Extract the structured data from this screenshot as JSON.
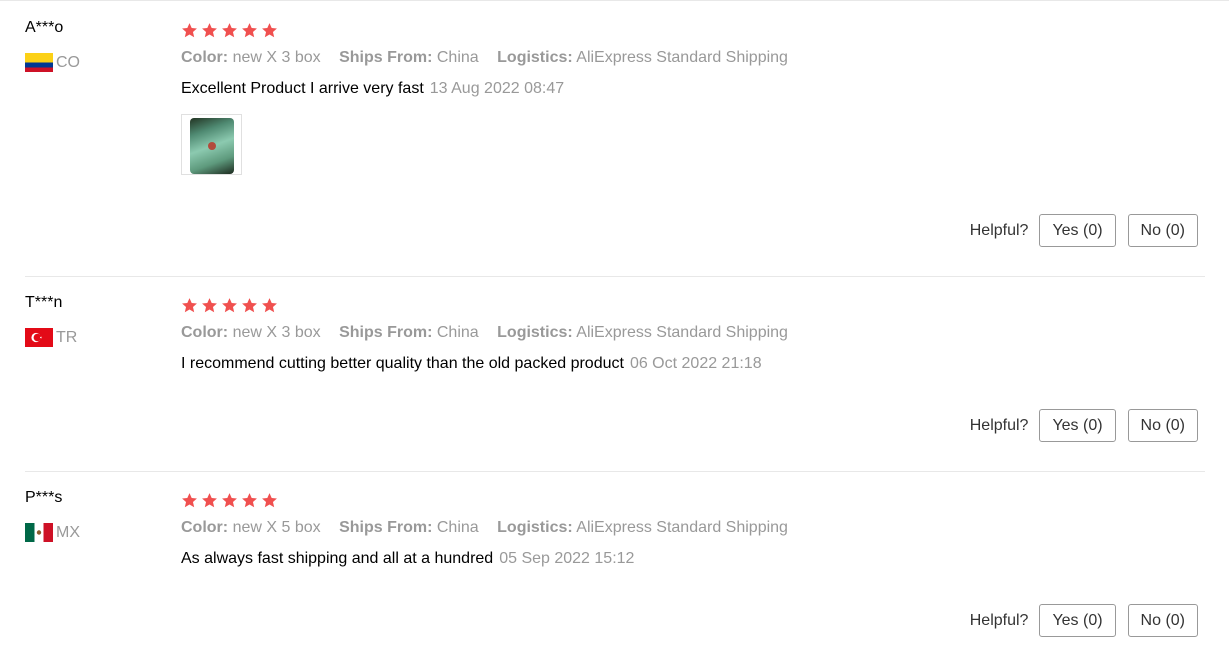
{
  "reviews": [
    {
      "user": "A***o",
      "country_code": "CO",
      "flag_icon": "flag-colombia",
      "rating": 5,
      "color_label": "Color:",
      "color_value": "new X 3 box",
      "ships_label": "Ships From:",
      "ships_value": "China",
      "logistics_label": "Logistics:",
      "logistics_value": "AliExpress Standard Shipping",
      "comment": "Excellent Product I arrive very fast",
      "date": "13 Aug 2022 08:47",
      "has_photo": true,
      "helpful_label": "Helpful?",
      "yes_label": "Yes (0)",
      "no_label": "No (0)"
    },
    {
      "user": "T***n",
      "country_code": "TR",
      "flag_icon": "flag-turkey",
      "rating": 5,
      "color_label": "Color:",
      "color_value": "new X 3 box",
      "ships_label": "Ships From:",
      "ships_value": "China",
      "logistics_label": "Logistics:",
      "logistics_value": "AliExpress Standard Shipping",
      "comment": "I recommend cutting better quality than the old packed product",
      "date": "06 Oct 2022 21:18",
      "has_photo": false,
      "helpful_label": "Helpful?",
      "yes_label": "Yes (0)",
      "no_label": "No (0)"
    },
    {
      "user": "P***s",
      "country_code": "MX",
      "flag_icon": "flag-mexico",
      "rating": 5,
      "color_label": "Color:",
      "color_value": "new X 5 box",
      "ships_label": "Ships From:",
      "ships_value": "China",
      "logistics_label": "Logistics:",
      "logistics_value": "AliExpress Standard Shipping",
      "comment": "As always fast shipping and all at a hundred",
      "date": "05 Sep 2022 15:12",
      "has_photo": false,
      "helpful_label": "Helpful?",
      "yes_label": "Yes (0)",
      "no_label": "No (0)"
    }
  ],
  "colors": {
    "star": "#f0504f",
    "muted_text": "#999999",
    "border": "#e8e8e8"
  }
}
